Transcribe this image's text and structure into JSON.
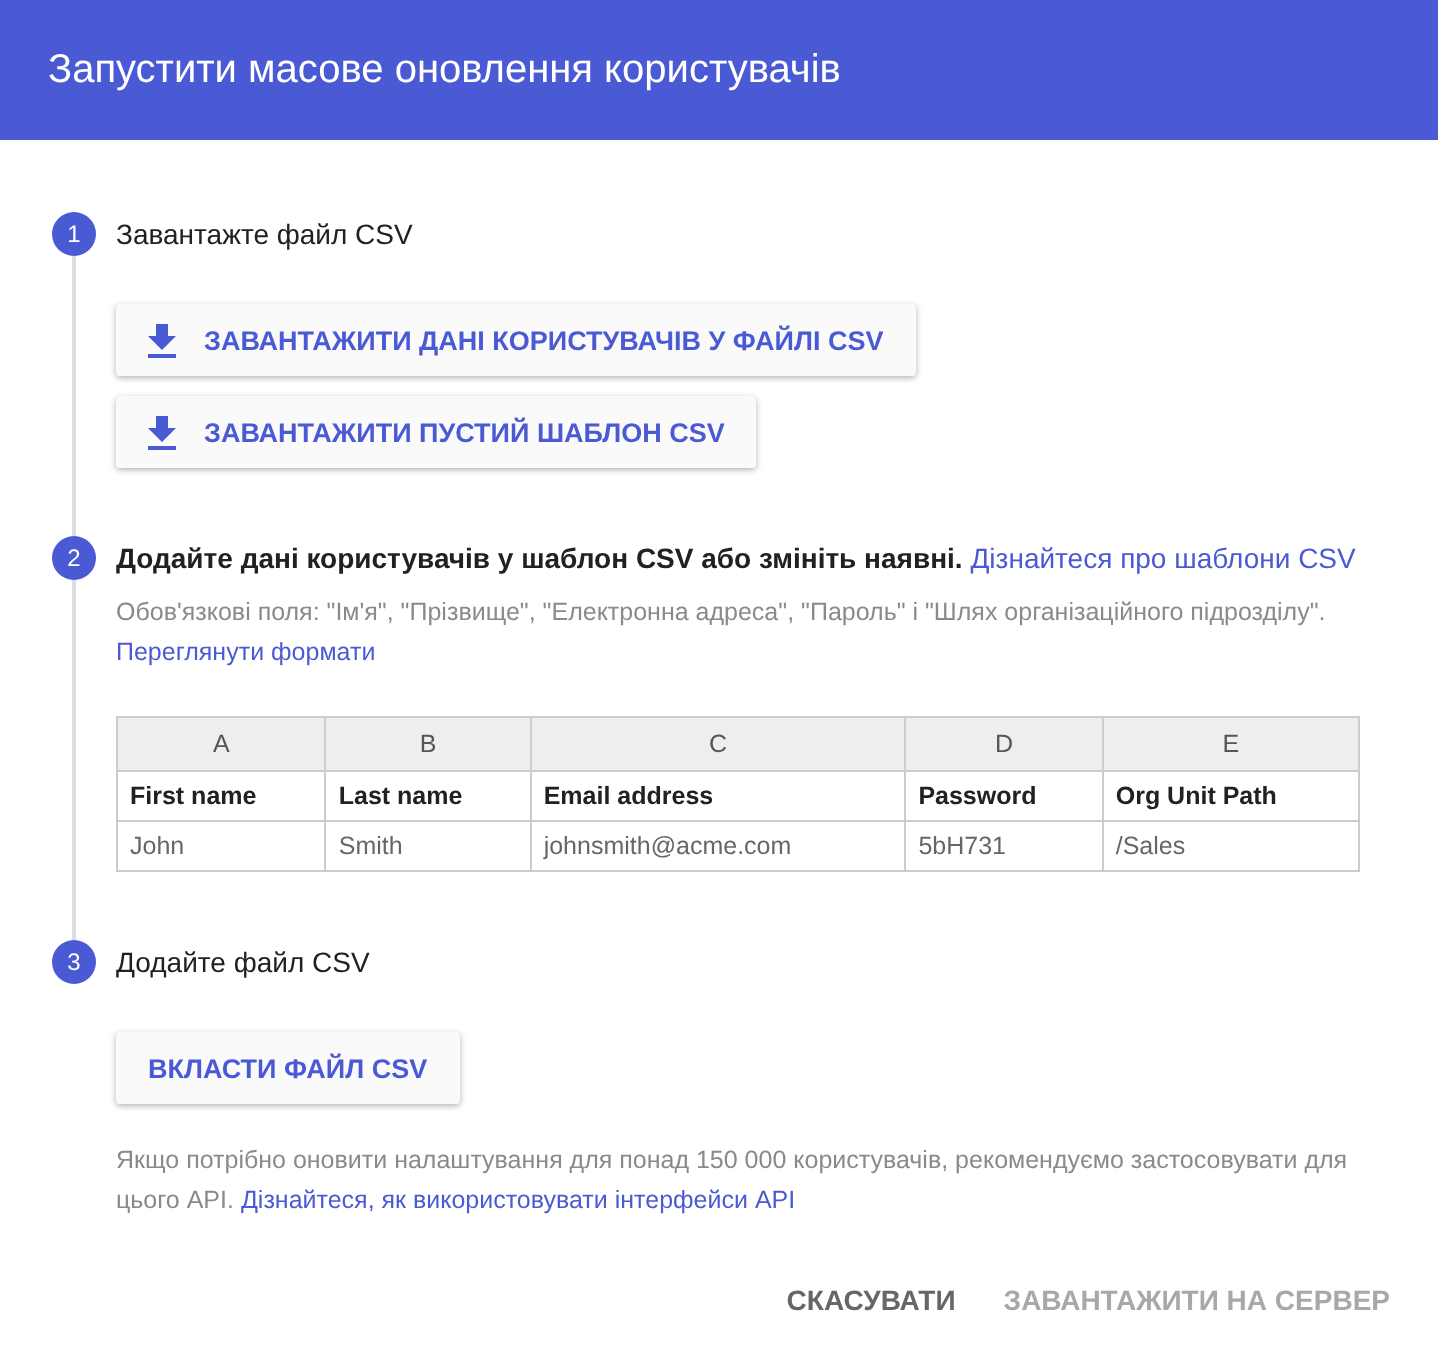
{
  "dialog": {
    "title": "Запустити масове оновлення користувачів"
  },
  "steps": [
    {
      "number": "1",
      "title": "Завантажте файл CSV",
      "downloads": [
        "ЗАВАНТАЖИТИ ДАНІ КОРИСТУВАЧІВ У ФАЙЛІ CSV",
        "ЗАВАНТАЖИТИ ПУСТИЙ ШАБЛОН CSV"
      ]
    },
    {
      "number": "2",
      "title": "Додайте дані користувачів у шаблон CSV або змініть наявні.",
      "title_link": "Дізнайтеся про шаблони CSV",
      "hint": "Обов'язкові поля: \"Ім'я\", \"Прізвище\", \"Електронна адреса\", \"Пароль\" і \"Шлях організаційного підрозділу\".",
      "hint_link": "Переглянути формати",
      "table": {
        "columns": [
          "A",
          "B",
          "C",
          "D",
          "E"
        ],
        "rows": [
          [
            "First name",
            "Last name",
            "Email address",
            "Password",
            "Org Unit Path"
          ],
          [
            "John",
            "Smith",
            "johnsmith@acme.com",
            "5bH731",
            "/Sales"
          ]
        ]
      }
    },
    {
      "number": "3",
      "title": "Додайте файл CSV",
      "button": "ВКЛАСТИ ФАЙЛ CSV",
      "note": "Якщо потрібно оновити налаштування для понад 150 000 користувачів, рекомендуємо застосовувати для цього API.",
      "note_link": "Дізнайтеся, як використовувати інтерфейси API"
    }
  ],
  "actions": [
    {
      "label": "СКАСУВАТИ",
      "disabled": false
    },
    {
      "label": "ЗАВАНТАЖИТИ НА СЕРВЕР",
      "disabled": true
    }
  ]
}
